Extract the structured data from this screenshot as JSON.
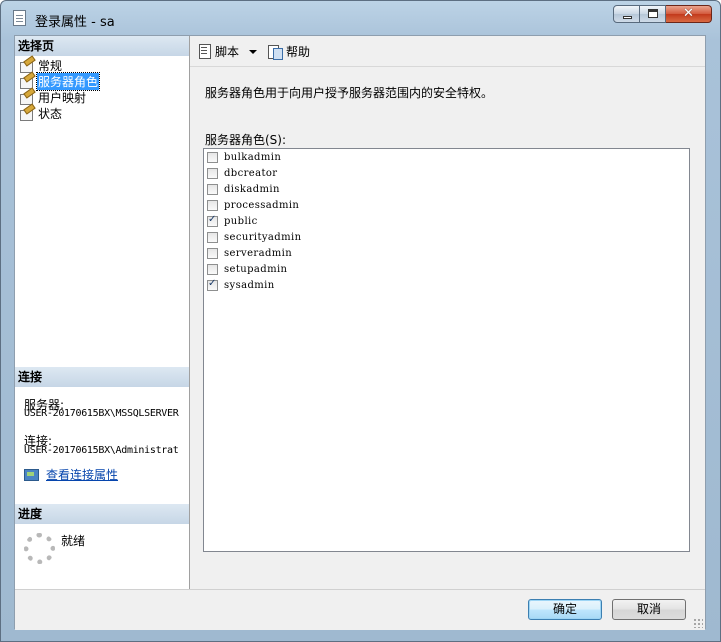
{
  "window": {
    "title": "登录属性 - sa"
  },
  "caption": {
    "close_glyph": "✕"
  },
  "left_pane": {
    "select_page_header": "选择页",
    "pages": [
      {
        "label": "常规",
        "selected": false
      },
      {
        "label": "服务器角色",
        "selected": true
      },
      {
        "label": "用户映射",
        "selected": false
      },
      {
        "label": "状态",
        "selected": false
      }
    ],
    "connection_header": "连接",
    "server_label": "服务器:",
    "server_value": "USER-20170615BX\\MSSQLSERVER",
    "connection_label": "连接:",
    "connection_value": "USER-20170615BX\\Administrat",
    "view_connection_link": "查看连接属性",
    "progress_header": "进度",
    "progress_status": "就绪"
  },
  "toolbar": {
    "script_label": "脚本",
    "help_label": "帮助"
  },
  "main": {
    "description": "服务器角色用于向用户授予服务器范围内的安全特权。",
    "roles_label": "服务器角色(S):",
    "roles": [
      {
        "name": "bulkadmin",
        "checked": false
      },
      {
        "name": "dbcreator",
        "checked": false
      },
      {
        "name": "diskadmin",
        "checked": false
      },
      {
        "name": "processadmin",
        "checked": false
      },
      {
        "name": "public",
        "checked": true
      },
      {
        "name": "securityadmin",
        "checked": false
      },
      {
        "name": "serveradmin",
        "checked": false
      },
      {
        "name": "setupadmin",
        "checked": false
      },
      {
        "name": "sysadmin",
        "checked": true
      }
    ]
  },
  "buttons": {
    "ok": "确定",
    "cancel": "取消"
  }
}
